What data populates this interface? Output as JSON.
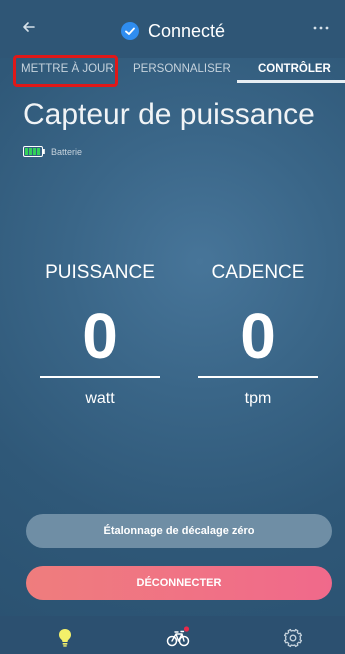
{
  "header": {
    "title": "Connecté",
    "back_icon": "arrow-left-icon",
    "status_icon": "check-circle-icon",
    "more_icon": "more-dots-icon"
  },
  "tabs": [
    {
      "label": "METTRE À JOUR"
    },
    {
      "label": "PERSONNALISER"
    },
    {
      "label": "CONTRÔLER",
      "active": true
    }
  ],
  "device": {
    "name": "Capteur de puissance",
    "battery_label": "Batterie"
  },
  "metrics": [
    {
      "label": "PUISSANCE",
      "value": "0",
      "unit": "watt"
    },
    {
      "label": "CADENCE",
      "value": "0",
      "unit": "tpm"
    }
  ],
  "actions": {
    "calibrate": "Étalonnage de décalage zéro",
    "disconnect": "DÉCONNECTER"
  },
  "bottom_nav": [
    {
      "icon": "bulb-icon",
      "active": true
    },
    {
      "icon": "bike-icon",
      "badge": true
    },
    {
      "icon": "gear-icon"
    }
  ],
  "colors": {
    "accent_yellow": "#f3f06a",
    "highlight_red": "#e01818",
    "disconnect_pink": "#f0698b"
  }
}
